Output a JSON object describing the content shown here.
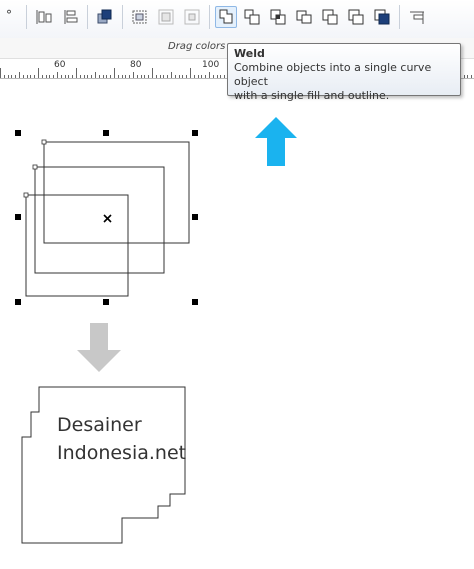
{
  "toolbar": {
    "buttons": [
      {
        "icon": "degree-icon",
        "active": false
      },
      {
        "icon": "align-left-icon",
        "active": false
      },
      {
        "icon": "align-tree-icon",
        "active": false
      },
      {
        "icon": "group-front-icon",
        "active": false
      },
      {
        "icon": "combine-icon",
        "active": false
      },
      {
        "icon": "break-apart-icon",
        "active": false
      },
      {
        "icon": "break-curve-icon",
        "active": false
      },
      {
        "icon": "weld-icon",
        "active": true
      },
      {
        "icon": "trim-icon",
        "active": false
      },
      {
        "icon": "intersect-icon",
        "active": false
      },
      {
        "icon": "simplify-icon",
        "active": false
      },
      {
        "icon": "front-minus-back-icon",
        "active": false
      },
      {
        "icon": "back-minus-front-icon",
        "active": false
      },
      {
        "icon": "boundary-icon",
        "active": false
      }
    ],
    "degree_symbol": "°"
  },
  "hint": {
    "text": "Drag colors"
  },
  "ruler": {
    "labels": [
      "60",
      "80",
      "100"
    ]
  },
  "tooltip": {
    "title": "Weld",
    "description_line1": "Combine objects into a single curve object",
    "description_line2": "with a single fill and outline."
  },
  "result": {
    "line1": "Desainer",
    "line2": "Indonesia.net"
  },
  "colors": {
    "arrow_up": "#1ab3ef",
    "arrow_down": "#c8c8c8",
    "tooltip_border": "#767676",
    "active_button": "#8fb8e6"
  }
}
